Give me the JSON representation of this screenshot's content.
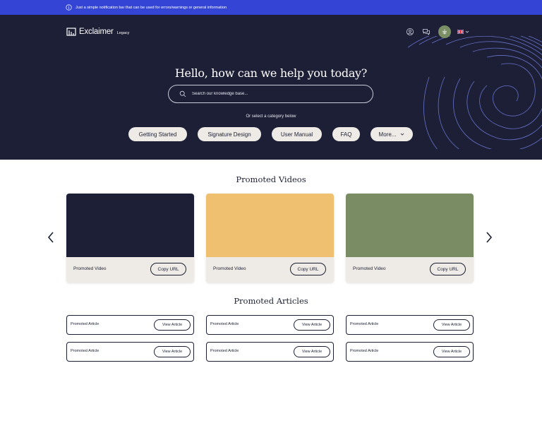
{
  "notification": {
    "icon": "info-icon",
    "text": "Just a simple notification bar that can be used for errors/warnings or general information",
    "color": "#3445d6"
  },
  "header": {
    "logo": {
      "word": "Exclaimer",
      "sub": "Legacy"
    },
    "icons": [
      "user-icon",
      "chat-icon",
      "avatar",
      "uk-flag-icon",
      "chevron-down-icon"
    ],
    "avatar_color": "#7a8f65",
    "background": "#1c1f35"
  },
  "hero": {
    "headline": "Hello, how can we help you today?",
    "search_placeholder": "Search our knowledge base...",
    "or_select": "Or select a category below",
    "categories": [
      "Getting Started",
      "Signature Design",
      "User Manual",
      "FAQ",
      "More..."
    ]
  },
  "videos": {
    "title": "Promoted Videos",
    "items": [
      {
        "label": "Promoted Video",
        "button": "Copy URL",
        "color": "#1c1f35"
      },
      {
        "label": "Promoted Video",
        "button": "Copy URL",
        "color": "#eec070"
      },
      {
        "label": "Promoted Video",
        "button": "Copy URL",
        "color": "#7a8c64"
      }
    ]
  },
  "articles": {
    "title": "Promoted Articles",
    "items": [
      {
        "label": "Promoted Article",
        "button": "View Article"
      },
      {
        "label": "Promoted Article",
        "button": "View Article"
      },
      {
        "label": "Promoted Article",
        "button": "View Article"
      },
      {
        "label": "Promoted Article",
        "button": "View Article"
      },
      {
        "label": "Promoted Article",
        "button": "View Article"
      },
      {
        "label": "Promoted Article",
        "button": "View Article"
      }
    ]
  }
}
